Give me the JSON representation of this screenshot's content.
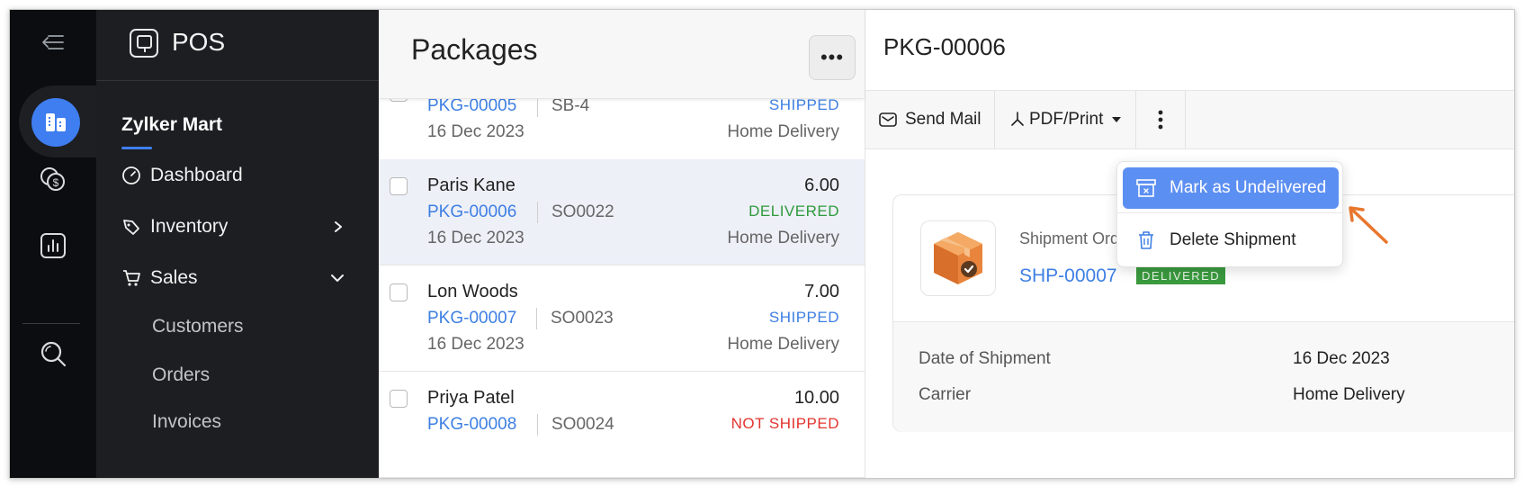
{
  "app": {
    "name": "POS",
    "org": "Zylker Mart"
  },
  "sidebar": {
    "nav": [
      {
        "label": "Dashboard"
      },
      {
        "label": "Inventory"
      },
      {
        "label": "Sales"
      }
    ],
    "sub": [
      {
        "label": "Customers"
      },
      {
        "label": "Orders"
      },
      {
        "label": "Invoices"
      }
    ]
  },
  "list": {
    "title": "Packages",
    "more_label": "•••",
    "rows": [
      {
        "customer": "",
        "pkg": "PKG-00005",
        "so": "SB-4",
        "date": "16 Dec 2023",
        "amount": "",
        "status": "SHIPPED",
        "method": "Home Delivery"
      },
      {
        "customer": "Paris Kane",
        "pkg": "PKG-00006",
        "so": "SO0022",
        "date": "16 Dec 2023",
        "amount": "6.00",
        "status": "DELIVERED",
        "method": "Home Delivery"
      },
      {
        "customer": "Lon Woods",
        "pkg": "PKG-00007",
        "so": "SO0023",
        "date": "16 Dec 2023",
        "amount": "7.00",
        "status": "SHIPPED",
        "method": "Home Delivery"
      },
      {
        "customer": "Priya Patel",
        "pkg": "PKG-00008",
        "so": "SO0024",
        "date": "",
        "amount": "10.00",
        "status": "NOT SHIPPED",
        "method": ""
      }
    ]
  },
  "detail": {
    "title": "PKG-00006",
    "toolbar": {
      "send_mail": "Send Mail",
      "pdf_print": "PDF/Print"
    },
    "menu": {
      "mark_undelivered": "Mark as Undelivered",
      "delete_shipment": "Delete Shipment"
    },
    "card": {
      "so_label": "Shipment Order",
      "shipment_no": "SHP-00007",
      "badge": "DELIVERED",
      "date_label": "Date of Shipment",
      "date_value": "16 Dec 2023",
      "carrier_label": "Carrier",
      "carrier_value": "Home Delivery"
    }
  },
  "colors": {
    "accent": "#3f7ef0",
    "link": "#3d7fe3",
    "shipped": "#3d7fe3",
    "delivered": "#2f9a3c",
    "not_shipped": "#e3342f",
    "arrow": "#e8772e"
  }
}
